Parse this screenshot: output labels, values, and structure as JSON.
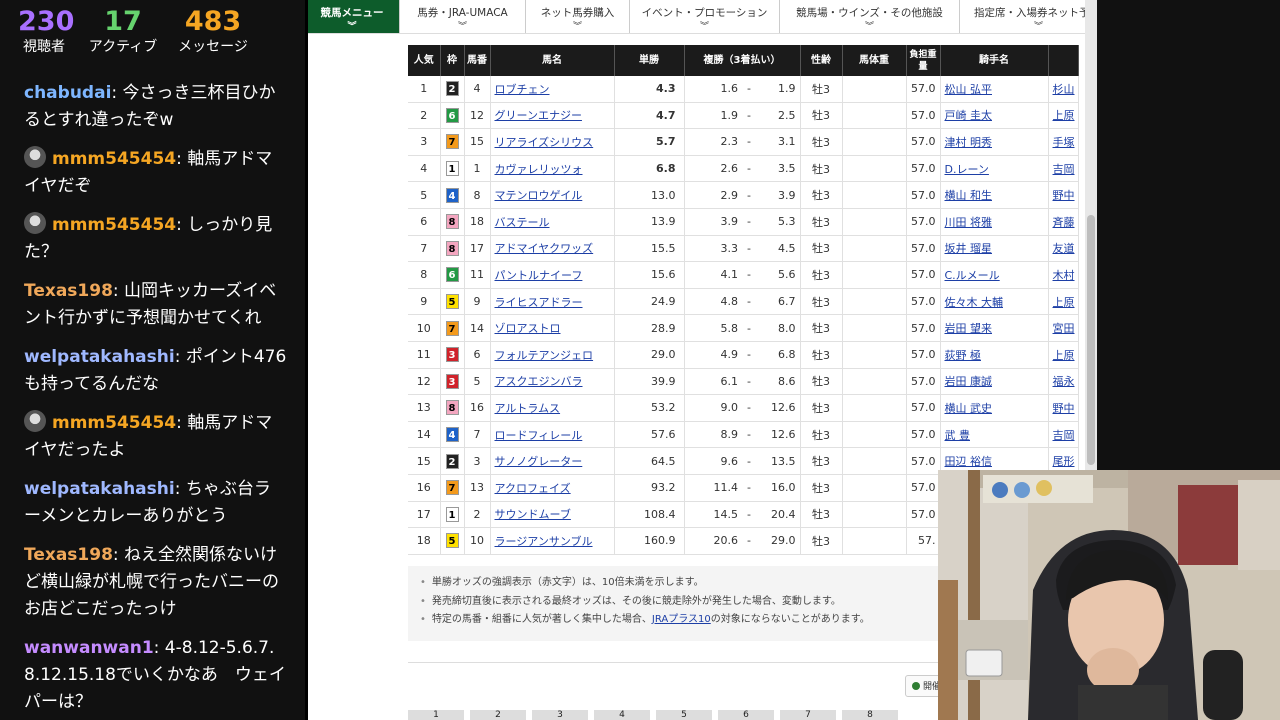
{
  "chat": {
    "stats": [
      {
        "value": "230",
        "label": "視聴者",
        "color": "#a970ff"
      },
      {
        "value": "17",
        "label": "アクティブ",
        "color": "#66d36e"
      },
      {
        "value": "483",
        "label": "メッセージ",
        "color": "#f5a623"
      }
    ],
    "messages": [
      {
        "user": "chabudai",
        "text": ": 今さっき三杯目ひかるとすれ違ったぞw",
        "color": "#7eb6ff",
        "avatar": false
      },
      {
        "user": "mmm545454",
        "text": ": 軸馬アドマイヤだぞ",
        "color": "#f5a623",
        "avatar": true
      },
      {
        "user": "mmm545454",
        "text": ": しっかり見た？",
        "color": "#f5a623",
        "avatar": true
      },
      {
        "user": "Texas198",
        "text": ": 山岡キッカーズイベント行かずに予想聞かせてくれ",
        "color": "#f0a85a",
        "avatar": false
      },
      {
        "user": "welpatakahashi",
        "text": ": ポイント476も持ってるんだな",
        "color": "#9fb8ff",
        "avatar": false
      },
      {
        "user": "mmm545454",
        "text": ": 軸馬アドマイヤだったよ",
        "color": "#f5a623",
        "avatar": true
      },
      {
        "user": "welpatakahashi",
        "text": ": ちゃぶ台ラーメンとカレーありがとう",
        "color": "#9fb8ff",
        "avatar": false
      },
      {
        "user": "Texas198",
        "text": ": ねえ全然関係ないけど横山緑が札幌で行ったバニーのお店どこだったっけ",
        "color": "#f0a85a",
        "avatar": false
      },
      {
        "user": "wanwanwan1",
        "text": ": 4-8.12-5.6.7.8.12.15.18でいくかなあ　ウェイパーは？",
        "color": "#c58cff",
        "avatar": false
      }
    ]
  },
  "nav": {
    "items": [
      "競馬メニュー",
      "馬券・JRA-UMACA",
      "ネット馬券購入",
      "イベント・プロモーション",
      "競馬場・ウインズ・その他施設",
      "指定席・入場券ネット予約"
    ],
    "active_color": "#0d5c2b"
  },
  "table": {
    "headers": {
      "rank": "人気",
      "waku": "枠",
      "umaban": "馬番",
      "name": "馬名",
      "tan": "単勝",
      "fuku": "複勝（3着払い）",
      "sex": "性齢",
      "bodyweight": "馬体重",
      "weight": "負担重量",
      "jockey": "騎手名"
    },
    "rows": [
      {
        "rank": "1",
        "waku": "2",
        "umaban": "4",
        "name": "ロブチェン",
        "tan": "4.3",
        "hot": true,
        "fmin": "1.6",
        "fmax": "1.9",
        "sex": "牡3",
        "wt": "57.0",
        "jockey": "松山 弘平",
        "trainer": "杉山"
      },
      {
        "rank": "2",
        "waku": "6",
        "umaban": "12",
        "name": "グリーンエナジー",
        "tan": "4.7",
        "hot": true,
        "fmin": "1.9",
        "fmax": "2.5",
        "sex": "牡3",
        "wt": "57.0",
        "jockey": "戸崎 圭太",
        "trainer": "上原"
      },
      {
        "rank": "3",
        "waku": "7",
        "umaban": "15",
        "name": "リアライズシリウス",
        "tan": "5.7",
        "hot": true,
        "fmin": "2.3",
        "fmax": "3.1",
        "sex": "牡3",
        "wt": "57.0",
        "jockey": "津村 明秀",
        "trainer": "手塚"
      },
      {
        "rank": "4",
        "waku": "1",
        "umaban": "1",
        "name": "カヴァレリッツォ",
        "tan": "6.8",
        "hot": true,
        "fmin": "2.6",
        "fmax": "3.5",
        "sex": "牡3",
        "wt": "57.0",
        "jockey": "D.レーン",
        "trainer": "吉岡"
      },
      {
        "rank": "5",
        "waku": "4",
        "umaban": "8",
        "name": "マテンロウゲイル",
        "tan": "13.0",
        "hot": false,
        "fmin": "2.9",
        "fmax": "3.9",
        "sex": "牡3",
        "wt": "57.0",
        "jockey": "横山 和生",
        "trainer": "野中"
      },
      {
        "rank": "6",
        "waku": "8",
        "umaban": "18",
        "name": "バステール",
        "tan": "13.9",
        "hot": false,
        "fmin": "3.9",
        "fmax": "5.3",
        "sex": "牡3",
        "wt": "57.0",
        "jockey": "川田 将雅",
        "trainer": "斉藤"
      },
      {
        "rank": "7",
        "waku": "8",
        "umaban": "17",
        "name": "アドマイヤクワッズ",
        "tan": "15.5",
        "hot": false,
        "fmin": "3.3",
        "fmax": "4.5",
        "sex": "牡3",
        "wt": "57.0",
        "jockey": "坂井 瑠星",
        "trainer": "友道"
      },
      {
        "rank": "8",
        "waku": "6",
        "umaban": "11",
        "name": "パントルナイーフ",
        "tan": "15.6",
        "hot": false,
        "fmin": "4.1",
        "fmax": "5.6",
        "sex": "牡3",
        "wt": "57.0",
        "jockey": "C.ルメール",
        "trainer": "木村"
      },
      {
        "rank": "9",
        "waku": "5",
        "umaban": "9",
        "name": "ライヒスアドラー",
        "tan": "24.9",
        "hot": false,
        "fmin": "4.8",
        "fmax": "6.7",
        "sex": "牡3",
        "wt": "57.0",
        "jockey": "佐々木 大輔",
        "trainer": "上原"
      },
      {
        "rank": "10",
        "waku": "7",
        "umaban": "14",
        "name": "ゾロアストロ",
        "tan": "28.9",
        "hot": false,
        "fmin": "5.8",
        "fmax": "8.0",
        "sex": "牡3",
        "wt": "57.0",
        "jockey": "岩田 望来",
        "trainer": "宮田"
      },
      {
        "rank": "11",
        "waku": "3",
        "umaban": "6",
        "name": "フォルテアンジェロ",
        "tan": "29.0",
        "hot": false,
        "fmin": "4.9",
        "fmax": "6.8",
        "sex": "牡3",
        "wt": "57.0",
        "jockey": "荻野 極",
        "trainer": "上原"
      },
      {
        "rank": "12",
        "waku": "3",
        "umaban": "5",
        "name": "アスクエジンバラ",
        "tan": "39.9",
        "hot": false,
        "fmin": "6.1",
        "fmax": "8.6",
        "sex": "牡3",
        "wt": "57.0",
        "jockey": "岩田 康誠",
        "trainer": "福永"
      },
      {
        "rank": "13",
        "waku": "8",
        "umaban": "16",
        "name": "アルトラムス",
        "tan": "53.2",
        "hot": false,
        "fmin": "9.0",
        "fmax": "12.6",
        "sex": "牡3",
        "wt": "57.0",
        "jockey": "横山 武史",
        "trainer": "野中"
      },
      {
        "rank": "14",
        "waku": "4",
        "umaban": "7",
        "name": "ロードフィレール",
        "tan": "57.6",
        "hot": false,
        "fmin": "8.9",
        "fmax": "12.6",
        "sex": "牡3",
        "wt": "57.0",
        "jockey": "武 豊",
        "trainer": "吉岡"
      },
      {
        "rank": "15",
        "waku": "2",
        "umaban": "3",
        "name": "サノノグレーター",
        "tan": "64.5",
        "hot": false,
        "fmin": "9.6",
        "fmax": "13.5",
        "sex": "牡3",
        "wt": "57.0",
        "jockey": "田辺 裕信",
        "trainer": "尾形"
      },
      {
        "rank": "16",
        "waku": "7",
        "umaban": "13",
        "name": "アクロフェイズ",
        "tan": "93.2",
        "hot": false,
        "fmin": "11.4",
        "fmax": "16.0",
        "sex": "牡3",
        "wt": "57.0",
        "jockey": "",
        "trainer": ""
      },
      {
        "rank": "17",
        "waku": "1",
        "umaban": "2",
        "name": "サウンドムーブ",
        "tan": "108.4",
        "hot": false,
        "fmin": "14.5",
        "fmax": "20.4",
        "sex": "牡3",
        "wt": "57.0",
        "jockey": "",
        "trainer": ""
      },
      {
        "rank": "18",
        "waku": "5",
        "umaban": "10",
        "name": "ラージアンサンブル",
        "tan": "160.9",
        "hot": false,
        "fmin": "20.6",
        "fmax": "29.0",
        "sex": "牡3",
        "wt": "57.",
        "jockey": "",
        "trainer": ""
      }
    ],
    "dash": "-"
  },
  "waku_colors": {
    "1": {
      "bg": "#ffffff",
      "fg": "#000000"
    },
    "2": {
      "bg": "#222222",
      "fg": "#ffffff"
    },
    "3": {
      "bg": "#d0222a",
      "fg": "#ffffff"
    },
    "4": {
      "bg": "#1e62c8",
      "fg": "#ffffff"
    },
    "5": {
      "bg": "#ffe100",
      "fg": "#000000"
    },
    "6": {
      "bg": "#229944",
      "fg": "#ffffff"
    },
    "7": {
      "bg": "#f39a1c",
      "fg": "#000000"
    },
    "8": {
      "bg": "#f4a6c0",
      "fg": "#000000"
    }
  },
  "notes": {
    "line1": "単勝オッズの強調表示（赤文字）は、10倍未満を示します。",
    "line2": "発売締切直後に表示される最終オッズは、その後に競走除外が発生した場合、変動します。",
    "line3_pre": "特定の馬番・組番に人気が著しく集中した場合、",
    "line3_link": "JRAプラス10",
    "line3_post": "の対象にならないことがあります。"
  },
  "misc_button": "開催",
  "bottom_tabs": [
    "1",
    "2",
    "3",
    "4",
    "5",
    "6",
    "7",
    "8"
  ]
}
